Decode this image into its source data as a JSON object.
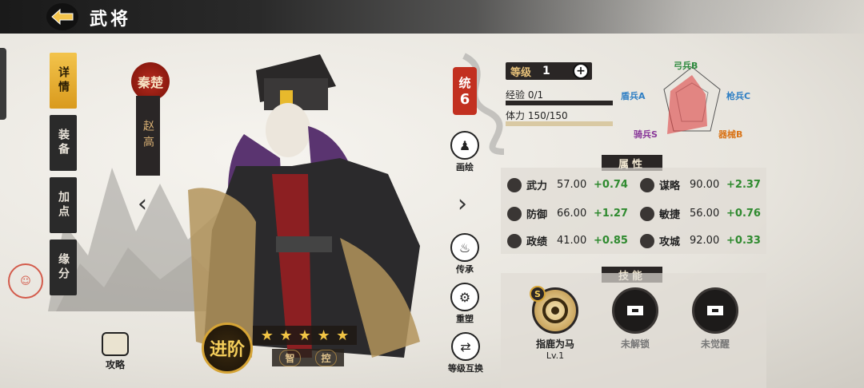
{
  "header": {
    "title": "武将"
  },
  "tabs": [
    {
      "label": "详情",
      "active": true
    },
    {
      "label": "装备",
      "active": false
    },
    {
      "label": "加点",
      "active": false
    },
    {
      "label": "缘分",
      "active": false
    }
  ],
  "hero": {
    "faction": "秦楚",
    "name": "赵高",
    "command_label": "统",
    "command_value": "6",
    "advance_label": "进阶",
    "stars": 5,
    "traits": [
      "智",
      "控"
    ]
  },
  "side_buttons": [
    {
      "label": "画绘",
      "icon": "portrait-icon"
    },
    {
      "label": "传承",
      "icon": "flame-icon"
    },
    {
      "label": "重塑",
      "icon": "reshape-icon"
    },
    {
      "label": "等级互换",
      "icon": "swap-icon"
    }
  ],
  "strategy": {
    "label": "攻略"
  },
  "level": {
    "label": "等级",
    "value": "1"
  },
  "exp": {
    "label": "经验",
    "value": "0/1",
    "fraction": 0
  },
  "stamina": {
    "label": "体力",
    "value": "150/150",
    "fraction": 1
  },
  "troops": [
    {
      "label": "弓兵B",
      "color": "#2f7fc4"
    },
    {
      "label": "枪兵C",
      "color": "#2e8a3e"
    },
    {
      "label": "器械B",
      "color": "#2f7fc4"
    },
    {
      "label": "骑兵S",
      "color": "#d97418"
    },
    {
      "label": "盾兵A",
      "color": "#8a3a9a"
    }
  ],
  "attributes_title": "属性",
  "attributes": [
    {
      "name": "武力",
      "value": "57.00",
      "bonus": "+0.74"
    },
    {
      "name": "谋略",
      "value": "90.00",
      "bonus": "+2.37"
    },
    {
      "name": "防御",
      "value": "66.00",
      "bonus": "+1.27"
    },
    {
      "name": "敏捷",
      "value": "56.00",
      "bonus": "+0.76"
    },
    {
      "name": "政绩",
      "value": "41.00",
      "bonus": "+0.85"
    },
    {
      "name": "攻城",
      "value": "92.00",
      "bonus": "+0.33"
    }
  ],
  "skills_title": "技能",
  "skills": [
    {
      "name": "指鹿为马",
      "level": "Lv.1",
      "grade": "S",
      "unlocked": true
    },
    {
      "name": "未解锁",
      "level": "",
      "unlocked": false
    },
    {
      "name": "未觉醒",
      "level": "",
      "unlocked": false
    }
  ]
}
